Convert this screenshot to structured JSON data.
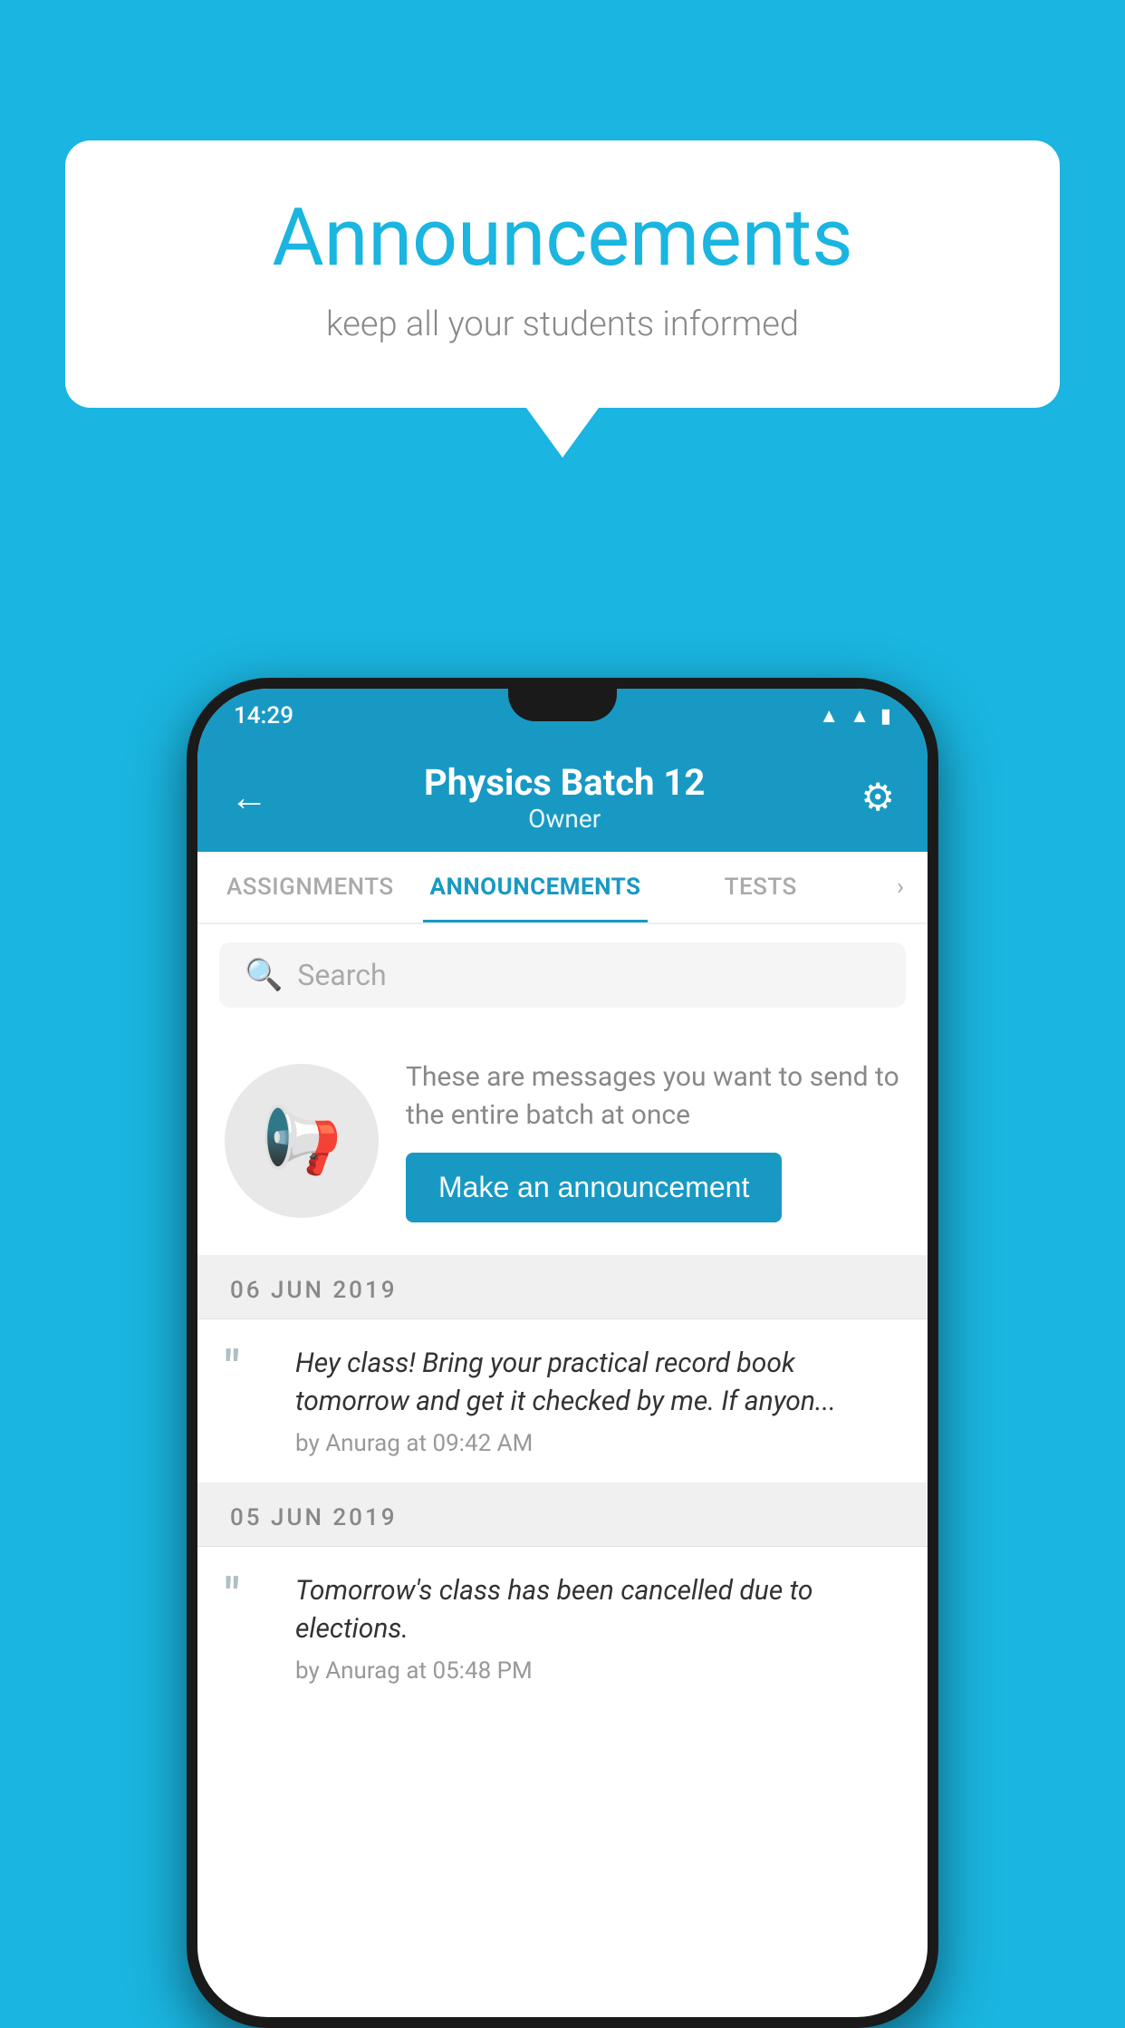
{
  "background_color": "#1ab5e0",
  "speech_bubble": {
    "title": "Announcements",
    "subtitle": "keep all your students informed"
  },
  "phone": {
    "status_bar": {
      "time": "14:29",
      "wifi_icon": "wifi",
      "signal_icon": "signal",
      "battery_icon": "battery"
    },
    "header": {
      "back_label": "←",
      "title": "Physics Batch 12",
      "subtitle": "Owner",
      "gear_label": "⚙"
    },
    "tabs": [
      {
        "label": "ASSIGNMENTS",
        "active": false
      },
      {
        "label": "ANNOUNCEMENTS",
        "active": true
      },
      {
        "label": "TESTS",
        "active": false
      }
    ],
    "search": {
      "placeholder": "Search"
    },
    "announcement_intro": {
      "description": "These are messages you want to\nsend to the entire batch at once",
      "button_label": "Make an announcement"
    },
    "date_separators": [
      "06  JUN  2019",
      "05  JUN  2019"
    ],
    "announcements": [
      {
        "message": "Hey class! Bring your practical record book tomorrow and get it checked by me. If anyon...",
        "author": "by Anurag at 09:42 AM"
      },
      {
        "message": "Tomorrow's class has been cancelled due to elections.",
        "author": "by Anurag at 05:48 PM"
      }
    ]
  }
}
